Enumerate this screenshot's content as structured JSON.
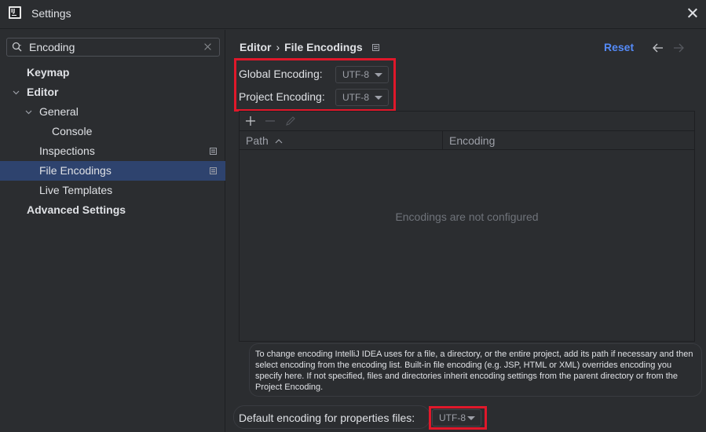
{
  "window": {
    "title": "Settings"
  },
  "search": {
    "value": "Encoding"
  },
  "sidebar": {
    "items": [
      {
        "label": "Keymap"
      },
      {
        "label": "Editor"
      },
      {
        "label": "General"
      },
      {
        "label": "Console"
      },
      {
        "label": "Inspections"
      },
      {
        "label": "File Encodings"
      },
      {
        "label": "Live Templates"
      },
      {
        "label": "Advanced Settings"
      }
    ]
  },
  "header": {
    "breadcrumb_root": "Editor",
    "breadcrumb_sep": "›",
    "breadcrumb_leaf": "File Encodings",
    "reset_label": "Reset"
  },
  "encodings": {
    "global_label": "Global Encoding:",
    "global_value": "UTF-8",
    "project_label": "Project Encoding:",
    "project_value": "UTF-8"
  },
  "table": {
    "columns": [
      "Path",
      "Encoding"
    ],
    "empty_text": "Encodings are not configured"
  },
  "info": {
    "text": "To change encoding IntelliJ IDEA uses for a file, a directory, or the entire project, add its path if necessary and then select encoding from the encoding list. Built-in file encoding (e.g. JSP, HTML or XML) overrides encoding you specify here. If not specified, files and directories inherit encoding settings from the parent directory or from the Project Encoding."
  },
  "properties": {
    "label": "Default encoding for properties files:",
    "value": "UTF-8"
  },
  "colors": {
    "background": "#2b2d30",
    "selection": "#2e436e",
    "link": "#548af7",
    "highlight": "#e0182a"
  }
}
